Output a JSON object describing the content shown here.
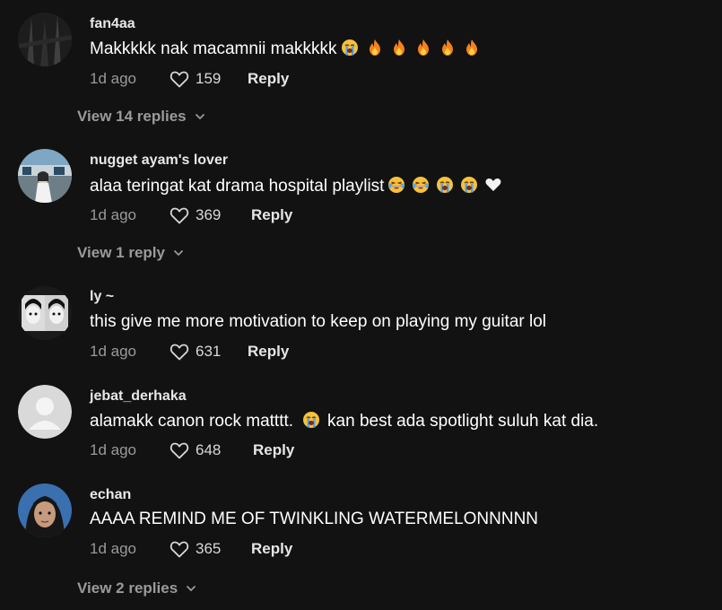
{
  "comments": [
    {
      "username": "fan4aa",
      "text": "Makkkkk nak macamnii makkkkk",
      "emojis": [
        "crying-face",
        "fire",
        "fire",
        "fire",
        "fire",
        "fire"
      ],
      "time": "1d ago",
      "likes": "159",
      "reply_label": "Reply",
      "view_replies": "View 14 replies"
    },
    {
      "username": "nugget ayam's lover",
      "text": "alaa teringat kat drama hospital playlist",
      "emojis": [
        "laughing-face",
        "laughing-face",
        "crying-face",
        "crying-face",
        "white-heart"
      ],
      "time": "1d ago",
      "likes": "369",
      "reply_label": "Reply",
      "view_replies": "View 1 reply"
    },
    {
      "username": "ly ~",
      "text": "this give me more motivation to keep on playing my guitar lol",
      "time": "1d ago",
      "likes": "631",
      "reply_label": "Reply"
    },
    {
      "username": "jebat_derhaka",
      "text_before": "alamakk canon rock matttt.",
      "text_after": "kan best ada spotlight suluh kat dia.",
      "time": "1d ago",
      "likes": "648",
      "reply_label": "Reply"
    },
    {
      "username": "echan",
      "text": "AAAA REMIND ME OF TWINKLING WATERMELONNNNN",
      "time": "1d ago",
      "likes": "365",
      "reply_label": "Reply",
      "view_replies": "View 2 replies"
    }
  ],
  "colors": {
    "background": "#121212",
    "muted": "#9a9a9a",
    "text": "#ffffff"
  }
}
